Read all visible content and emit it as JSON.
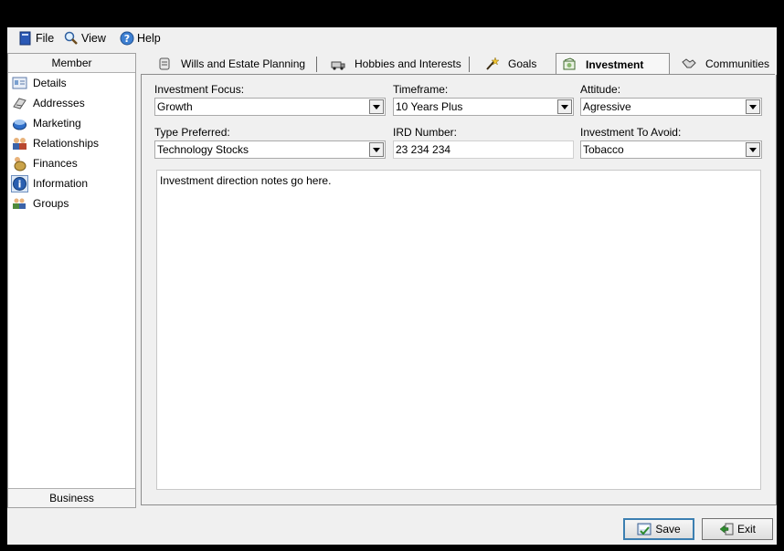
{
  "menu": {
    "items": [
      {
        "label": "File",
        "icon": "file-icon"
      },
      {
        "label": "View",
        "icon": "magnifier-icon"
      },
      {
        "label": "Help",
        "icon": "help-icon"
      }
    ]
  },
  "sidebar": {
    "header": "Member",
    "footer": "Business",
    "items": [
      {
        "label": "Details",
        "icon": "details-icon"
      },
      {
        "label": "Addresses",
        "icon": "address-book-icon"
      },
      {
        "label": "Marketing",
        "icon": "marketing-icon"
      },
      {
        "label": "Relationships",
        "icon": "people-icon"
      },
      {
        "label": "Finances",
        "icon": "money-bag-icon"
      },
      {
        "label": "Information",
        "icon": "info-icon"
      },
      {
        "label": "Groups",
        "icon": "group-icon"
      }
    ],
    "selected": "Information"
  },
  "tabs": [
    {
      "label": "Wills and Estate Planning",
      "icon": "scroll-icon"
    },
    {
      "label": "Hobbies and Interests",
      "icon": "truck-icon"
    },
    {
      "label": "Goals",
      "icon": "wand-icon"
    },
    {
      "label": "Investment",
      "icon": "money-icon"
    },
    {
      "label": "Communities",
      "icon": "handshake-icon"
    }
  ],
  "active_tab": "Investment",
  "form": {
    "investment_focus": {
      "label": "Investment Focus:",
      "value": "Growth"
    },
    "timeframe": {
      "label": "Timeframe:",
      "value": "10 Years Plus"
    },
    "attitude": {
      "label": "Attitude:",
      "value": "Agressive"
    },
    "type_preferred": {
      "label": "Type Preferred:",
      "value": "Technology Stocks"
    },
    "ird_number": {
      "label": "IRD Number:",
      "value": "23 234 234"
    },
    "investment_to_avoid": {
      "label": "Investment To Avoid:",
      "value": "Tobacco"
    },
    "notes": "Investment direction notes go here."
  },
  "buttons": {
    "save": "Save",
    "exit": "Exit"
  },
  "colors": {
    "window_bg": "#f0f0f0",
    "outer_bg": "#000000",
    "focus_border": "#3c7fb1"
  }
}
